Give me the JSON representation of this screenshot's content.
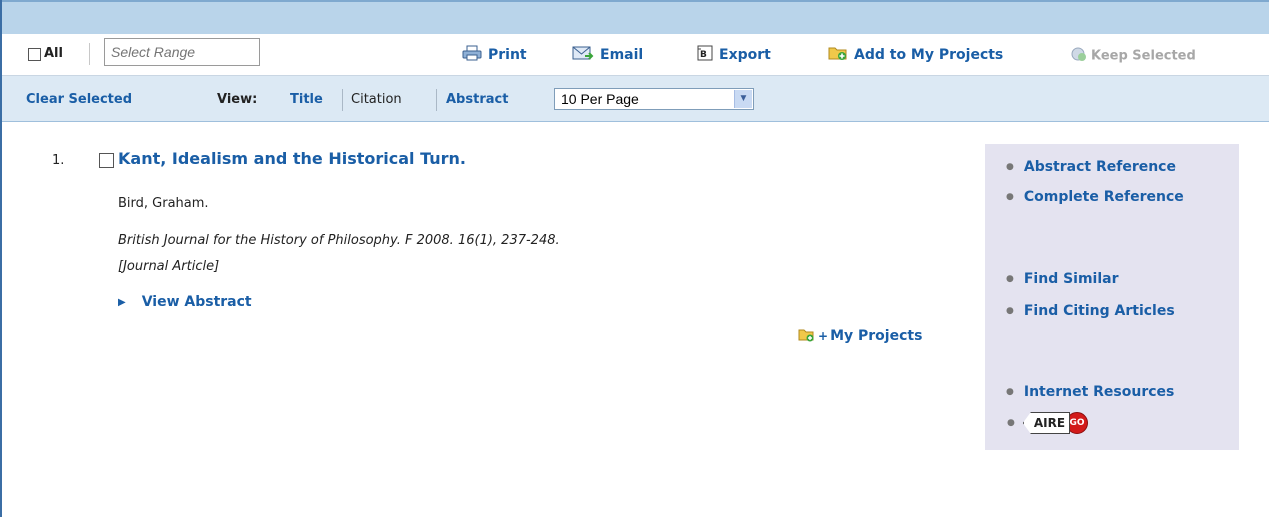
{
  "toolbar": {
    "all_label": "All",
    "range_placeholder": "Select Range",
    "print_label": "Print",
    "email_label": "Email",
    "export_label": "Export",
    "add_projects_label": "Add to My Projects",
    "keep_selected_label": "Keep Selected"
  },
  "display_bar": {
    "clear_selected_label": "Clear Selected",
    "view_label": "View:",
    "view_options": [
      "Title",
      "Citation",
      "Abstract"
    ],
    "per_page_value": "10 Per Page"
  },
  "results": [
    {
      "number": "1.",
      "title": "Kant, Idealism and the Historical Turn.",
      "author": "Bird, Graham.",
      "source": "British Journal for the History of Philosophy. F 2008. 16(1), 237-248.",
      "type": "[Journal Article]",
      "view_abstract_label": "View Abstract",
      "my_projects_label": "My Projects",
      "my_projects_prefix": "+"
    }
  ],
  "side_panel": {
    "abstract_reference": "Abstract Reference",
    "complete_reference": "Complete Reference",
    "find_similar": "Find Similar",
    "find_citing": "Find Citing Articles",
    "internet_resources": "Internet Resources",
    "aire_label": "AIRE",
    "go_label": "GO"
  },
  "colors": {
    "link": "#1a5ea6",
    "top_strip": "#b9d4ea",
    "display_bar": "#dce9f4",
    "side_panel": "#e4e3f0"
  }
}
